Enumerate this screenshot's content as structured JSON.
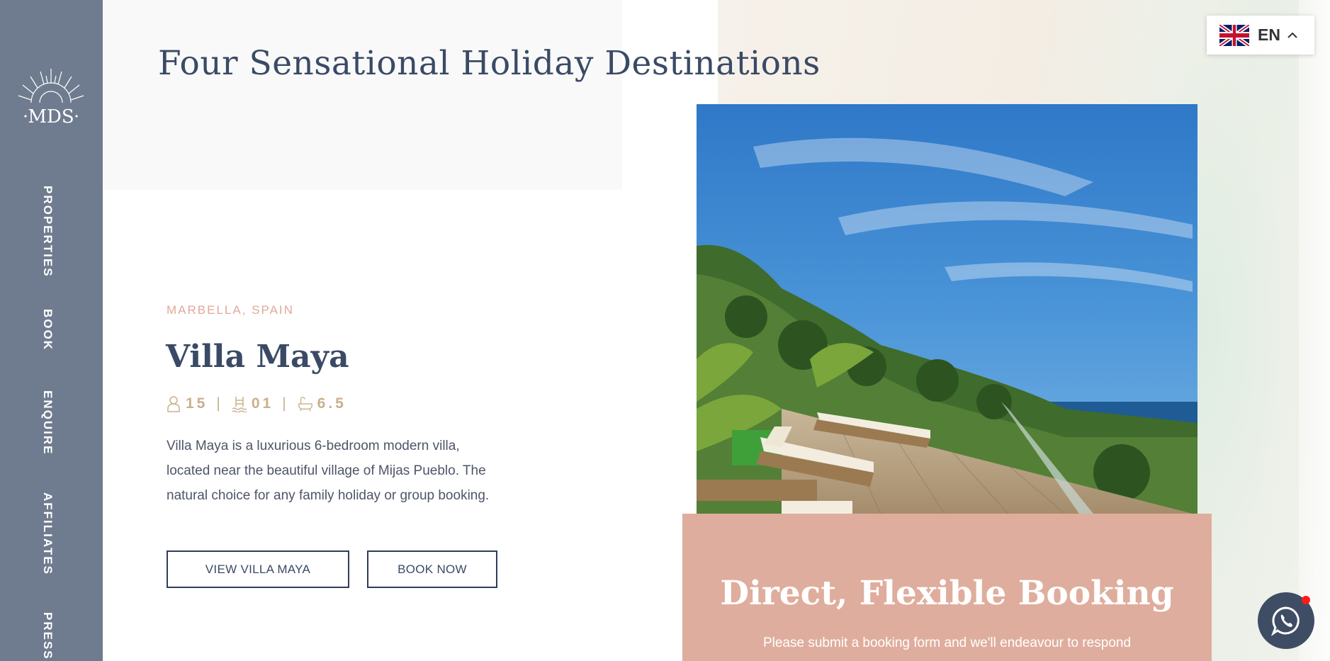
{
  "brand": {
    "logo_text": "MDS"
  },
  "sidebar": {
    "items": [
      {
        "label": "PROPERTIES"
      },
      {
        "label": "BOOK"
      },
      {
        "label": "ENQUIRE"
      },
      {
        "label": "AFFILIATES"
      },
      {
        "label": "PRESS"
      }
    ]
  },
  "main": {
    "title": "Four Sensational Holiday Destinations",
    "property": {
      "location": "MARBELLA, SPAIN",
      "name": "Villa Maya",
      "stats": {
        "guests": "15",
        "pools": "01",
        "bathrooms": "6.5",
        "separator": "|"
      },
      "description": "Villa Maya is a luxurious 6-bedroom modern villa, located near the beautiful village of Mijas Pueblo. The natural choice for any family holiday or group booking.",
      "buttons": {
        "view": "VIEW VILLA MAYA",
        "book": "BOOK NOW"
      }
    },
    "booking": {
      "title": "Direct, Flexible Booking",
      "text": "Please submit a booking form and we'll endeavour to respond"
    }
  },
  "language": {
    "code": "EN"
  },
  "icons": {
    "guests": "person-icon",
    "pools": "pool-icon",
    "bathrooms": "bathtub-icon",
    "language_flag": "uk-flag-icon",
    "chat": "whatsapp-icon"
  },
  "colors": {
    "sidebar": "#6f7c8f",
    "title": "#3a4a66",
    "accent": "#dfa998",
    "booking_card": "#dfad9d",
    "stats": "#c9b08c"
  }
}
